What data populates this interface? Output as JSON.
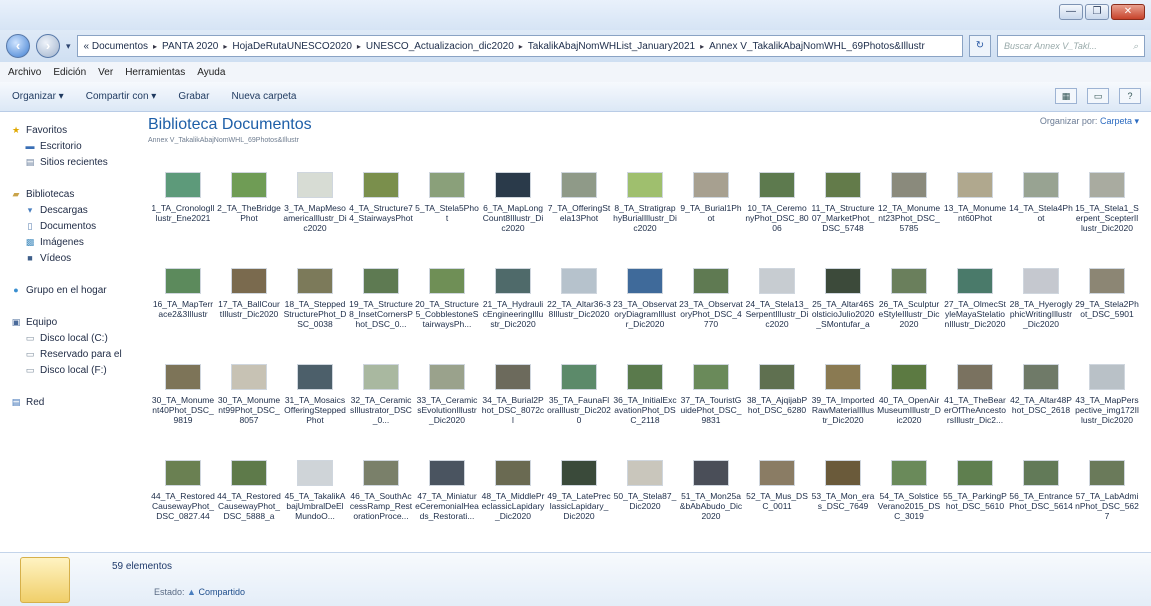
{
  "window": {
    "min": "—",
    "max": "❐",
    "close": "✕"
  },
  "address": {
    "crumbs": [
      "« Documentos",
      "PANTA 2020",
      "HojaDeRutaUNESCO2020",
      "UNESCO_Actualizacion_dic2020",
      "TakalikAbajNomWHList_January2021",
      "Annex V_TakalikAbajNomWHL_69Photos&Illustr"
    ],
    "search_placeholder": "Buscar Annex V_Takl..."
  },
  "menu": [
    "Archivo",
    "Edición",
    "Ver",
    "Herramientas",
    "Ayuda"
  ],
  "toolbar": {
    "organize": "Organizar ▾",
    "share": "Compartir con ▾",
    "burn": "Grabar",
    "new_folder": "Nueva carpeta"
  },
  "nav": {
    "favorites": {
      "label": "Favoritos",
      "items": [
        "Escritorio",
        "Sitios recientes"
      ]
    },
    "libraries": {
      "label": "Bibliotecas",
      "items": [
        "Descargas",
        "Documentos",
        "Imágenes",
        "Vídeos"
      ]
    },
    "homegroup": "Grupo en el hogar",
    "computer": {
      "label": "Equipo",
      "items": [
        "Disco local (C:)",
        "Reservado para el",
        "Disco local (F:)"
      ]
    },
    "network": "Red"
  },
  "library": {
    "title": "Biblioteca Documentos",
    "subtitle": "Annex V_TakalikAbajNomWHL_69Photos&Illustr",
    "arrange_label": "Organizar por:",
    "arrange_value": "Carpeta ▾"
  },
  "files": [
    {
      "n": "1_TA_CronologIllustr_Ene2021",
      "c": "#5d9a7a"
    },
    {
      "n": "2_TA_TheBridgePhot",
      "c": "#6f9c55"
    },
    {
      "n": "3_TA_MapMesoamericaIllustr_Dic2020",
      "c": "#d7dcd4"
    },
    {
      "n": "4_TA_Structure74_StairwaysPhot",
      "c": "#7a8f4c"
    },
    {
      "n": "5_TA_Stela5Phot",
      "c": "#8aa07a"
    },
    {
      "n": "6_TA_MapLongCount8Illustr_Dic2020",
      "c": "#2a3a4a"
    },
    {
      "n": "7_TA_OfferingStela13Phot",
      "c": "#8f9a88"
    },
    {
      "n": "8_TA_StratigraphyBurialIllustr_Dic2020",
      "c": "#9fbf6e"
    },
    {
      "n": "9_TA_Burial1Phot",
      "c": "#a7a090"
    },
    {
      "n": "10_TA_CeremonyPhot_DSC_8006",
      "c": "#5d7a4e"
    },
    {
      "n": "11_TA_Structure07_MarketPhot_DSC_5748",
      "c": "#637b4a"
    },
    {
      "n": "12_TA_Monument23Phot_DSC_5785",
      "c": "#8a8a7c"
    },
    {
      "n": "13_TA_Monument60Phot",
      "c": "#b0a88e"
    },
    {
      "n": "14_TA_Stela4Phot",
      "c": "#98a392"
    },
    {
      "n": "15_TA_Stela1_Serpent_ScepterIllustr_Dic2020",
      "c": "#a9aba0"
    },
    {
      "n": "16_TA_MapTerrace2&3Illustr",
      "c": "#5c8a5c"
    },
    {
      "n": "17_TA_BallCourtIllustr_Dic2020",
      "c": "#7a6a4e"
    },
    {
      "n": "18_TA_SteppedStructurePhot_DSC_0038",
      "c": "#7c7a5a"
    },
    {
      "n": "19_TA_Structure8_InsetCornersPhot_DSC_0...",
      "c": "#5e7a52"
    },
    {
      "n": "20_TA_Structure5_CobblestoneStairwaysPh...",
      "c": "#6f8f56"
    },
    {
      "n": "21_TA_HydraulicEngineeringIllustr_Dic2020",
      "c": "#4f6a6a"
    },
    {
      "n": "22_TA_Altar36-38Illustr_Dic2020",
      "c": "#b6c2cc"
    },
    {
      "n": "23_TA_ObservatoryDiagramIllustr_Dic2020",
      "c": "#3f6a9a"
    },
    {
      "n": "23_TA_ObservatoryPhot_DSC_4770",
      "c": "#5f7a52"
    },
    {
      "n": "24_TA_Stela13_SerpentIllustr_Dic2020",
      "c": "#c7ccd1"
    },
    {
      "n": "25_TA_Altar46SolsticioJulio2020_SMontufar_a",
      "c": "#3c4a3a"
    },
    {
      "n": "26_TA_SculptureStyleIllustr_Dic2020",
      "c": "#6a7f5c"
    },
    {
      "n": "27_TA_OlmecStyleMayaStelationIllustr_Dic2020",
      "c": "#4a7a6a"
    },
    {
      "n": "28_TA_HyeroglyphicWritingIllustr_Dic2020",
      "c": "#c5c8cf"
    },
    {
      "n": "29_TA_Stela2Phot_DSC_5901",
      "c": "#8c8674"
    },
    {
      "n": "30_TA_Monument40Phot_DSC_9819",
      "c": "#7d7458"
    },
    {
      "n": "30_TA_Monument99Phot_DSC_8057",
      "c": "#c7c2b4"
    },
    {
      "n": "31_TA_MosaicsOfferingSteppedPhot",
      "c": "#4c5f6a"
    },
    {
      "n": "32_TA_CeramicsIllustrator_DSC_0...",
      "c": "#a9b8a0"
    },
    {
      "n": "33_TA_CeramicsEvolutionIllustr_Dic2020",
      "c": "#9aa28c"
    },
    {
      "n": "34_TA_Burial2Phot_DSC_8072cl",
      "c": "#6c6a5c"
    },
    {
      "n": "35_TA_FaunaFloraIllustr_Dic2020",
      "c": "#5c8a6a"
    },
    {
      "n": "36_TA_InitialExcavationPhot_DSC_2118",
      "c": "#5a7a4c"
    },
    {
      "n": "37_TA_TouristGuidePhot_DSC_9831",
      "c": "#6a8a5a"
    },
    {
      "n": "38_TA_AjqijabPhot_DSC_6280",
      "c": "#5f7050"
    },
    {
      "n": "39_TA_ImportedRawMaterialIllustr_Dic2020",
      "c": "#8a7a52"
    },
    {
      "n": "40_TA_OpenAirMuseumIllustr_Dic2020",
      "c": "#5c7a42"
    },
    {
      "n": "41_TA_TheBearerOfTheAncestorsIllustr_Dic2...",
      "c": "#7a7260"
    },
    {
      "n": "42_TA_Altar48Phot_DSC_2618",
      "c": "#6f7a68"
    },
    {
      "n": "43_TA_MapPerspective_img172Illustr_Dic2020",
      "c": "#b9c1c7"
    },
    {
      "n": "44_TA_RestoredCausewayPhot_DSC_0827.44",
      "c": "#6a8052"
    },
    {
      "n": "44_TA_RestoredCausewayPhot_DSC_5888_a",
      "c": "#5e7a4a"
    },
    {
      "n": "45_TA_TakalikAbajUmbralDeElMundoO...",
      "c": "#cfd4d8"
    },
    {
      "n": "46_TA_SouthAccessRamp_RestorationProce...",
      "c": "#7a806a"
    },
    {
      "n": "47_TA_MiniatureCeremonialHeads_Restorati...",
      "c": "#4a5460"
    },
    {
      "n": "48_TA_MiddlePreclassicLapidary_Dic2020",
      "c": "#6a6a52"
    },
    {
      "n": "49_TA_LatePreclassicLapidary_Dic2020",
      "c": "#3a4a3a"
    },
    {
      "n": "50_TA_Stela87_Dic2020",
      "c": "#c9c6bc"
    },
    {
      "n": "51_TA_Mon25a&bAbAbudo_Dic2020",
      "c": "#4a4e58"
    },
    {
      "n": "52_TA_Mus_DSC_0011",
      "c": "#8a7c64"
    },
    {
      "n": "53_TA_Mon_eras_DSC_7649",
      "c": "#6a5a3a"
    },
    {
      "n": "54_TA_SolsticeVerano2015_DSC_3019",
      "c": "#6a8a5a"
    },
    {
      "n": "55_TA_ParkingPhot_DSC_5610",
      "c": "#5f7f4f"
    },
    {
      "n": "56_TA_EntrancePhot_DSC_5614",
      "c": "#627a58"
    },
    {
      "n": "57_TA_LabAdminPhot_DSC_5627",
      "c": "#6a7a5a"
    }
  ],
  "details": {
    "count": "59 elementos",
    "state_label": "Estado:",
    "state_value": "Compartido"
  }
}
